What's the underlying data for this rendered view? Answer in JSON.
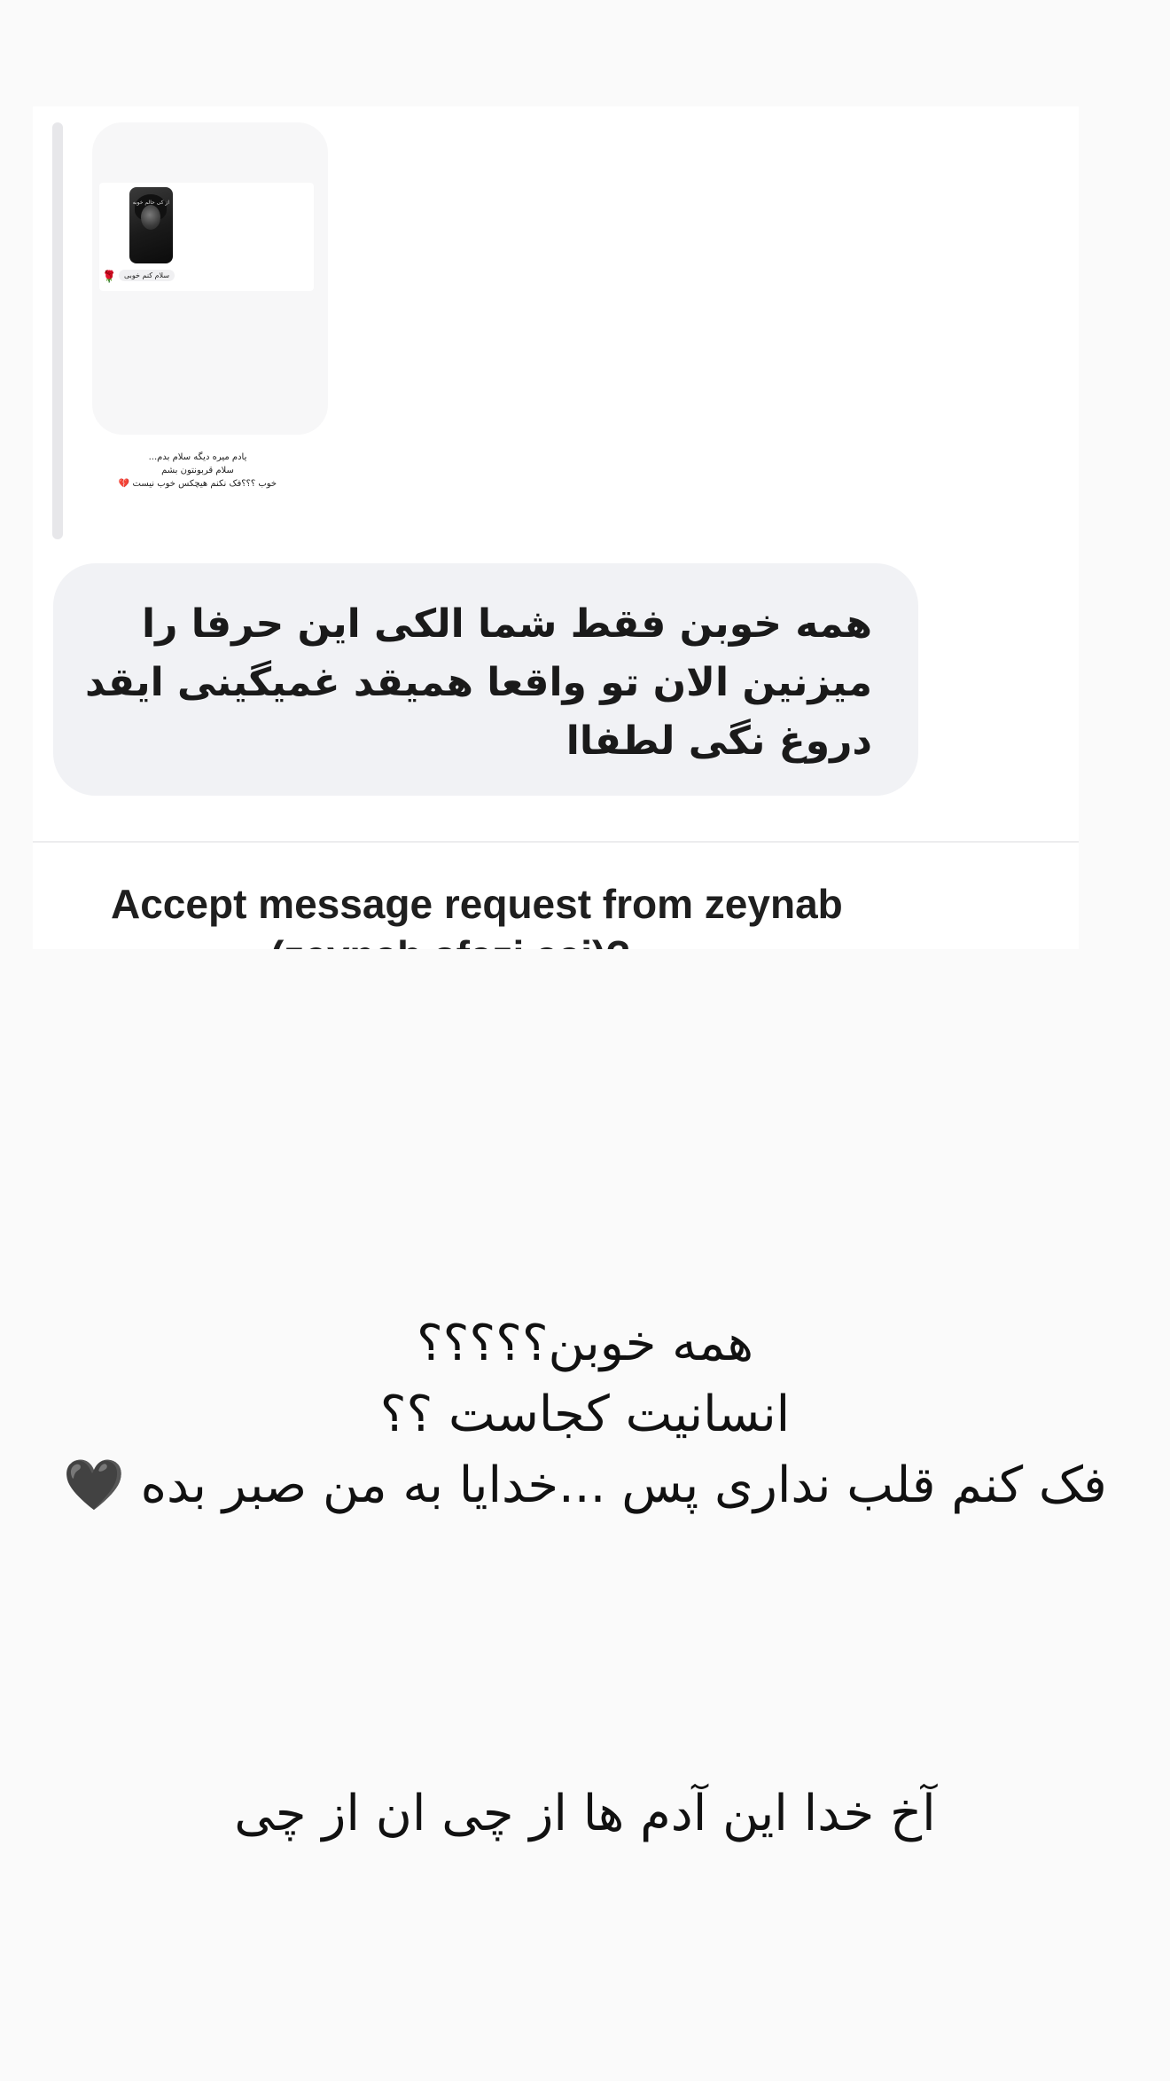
{
  "shared_story": {
    "overlay_text": "از کی حالم خوبه",
    "reaction_emoji": "🌹",
    "caption_chip": "سلام کنم خوبی",
    "text_lines": [
      "یادم میره دیگه سلام بدم...",
      "سلام قربونتون بشم",
      "خوب ؟؟؟فک نکنم هیچکس خوب نیست 💔"
    ]
  },
  "message": {
    "lines": [
      "همه خوبن فقط شما الکی این حرفا را",
      "میزنین الان تو واقعا همیقد غمیگینی ایقد",
      "دروغ نگی لطفاا"
    ]
  },
  "message_request": {
    "line1": "Accept message request from zeynab",
    "line2": "(zeynab.sfazi.aai)?"
  },
  "story_caption": {
    "lines": [
      "همه خوبن؟؟؟؟؟",
      "انسانیت کجاست ؟؟",
      "فک کنم قلب نداری پس ...خدایا به من صبر بده 🖤"
    ],
    "bottom_line": "آخ خدا این آدم ها از چی ان از چی"
  }
}
